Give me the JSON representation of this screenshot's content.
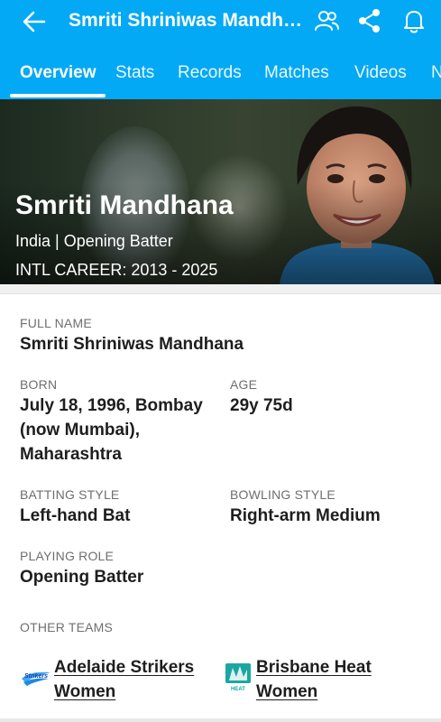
{
  "header": {
    "title": "Smriti Shriniwas Mandha…",
    "icons": [
      "back-arrow-icon",
      "people-icon",
      "share-icon",
      "bell-icon"
    ]
  },
  "tabs": [
    {
      "label": "Overview",
      "active": true
    },
    {
      "label": "Stats"
    },
    {
      "label": "Records"
    },
    {
      "label": "Matches"
    },
    {
      "label": "Videos"
    },
    {
      "label": "N"
    }
  ],
  "hero": {
    "name": "Smriti Mandhana",
    "meta": "India | Opening Batter",
    "career": "INTL CAREER: 2013 - 2025"
  },
  "profile": {
    "full_name_label": "FULL NAME",
    "full_name": "Smriti Shriniwas Mandhana",
    "born_label": "BORN",
    "born_line1": "July 18, 1996, Bombay",
    "born_line2": "(now Mumbai),",
    "born_line3": "Maharashtra",
    "age_label": "AGE",
    "age": "29y 75d",
    "batting_label": "BATTING STYLE",
    "batting": "Left-hand Bat",
    "bowling_label": "BOWLING STYLE",
    "bowling": "Right-arm Medium",
    "role_label": "PLAYING ROLE",
    "role": "Opening Batter",
    "other_teams_label": "OTHER TEAMS"
  },
  "teams": [
    {
      "line1": "Adelaide Strikers",
      "line2": "Women",
      "logo": "adelaide-strikers-logo"
    },
    {
      "line1": "Brisbane Heat",
      "line2": "Women",
      "logo": "brisbane-heat-logo"
    }
  ],
  "colors": {
    "accent": "#03a9f4",
    "heat": "#1aa7a1"
  }
}
